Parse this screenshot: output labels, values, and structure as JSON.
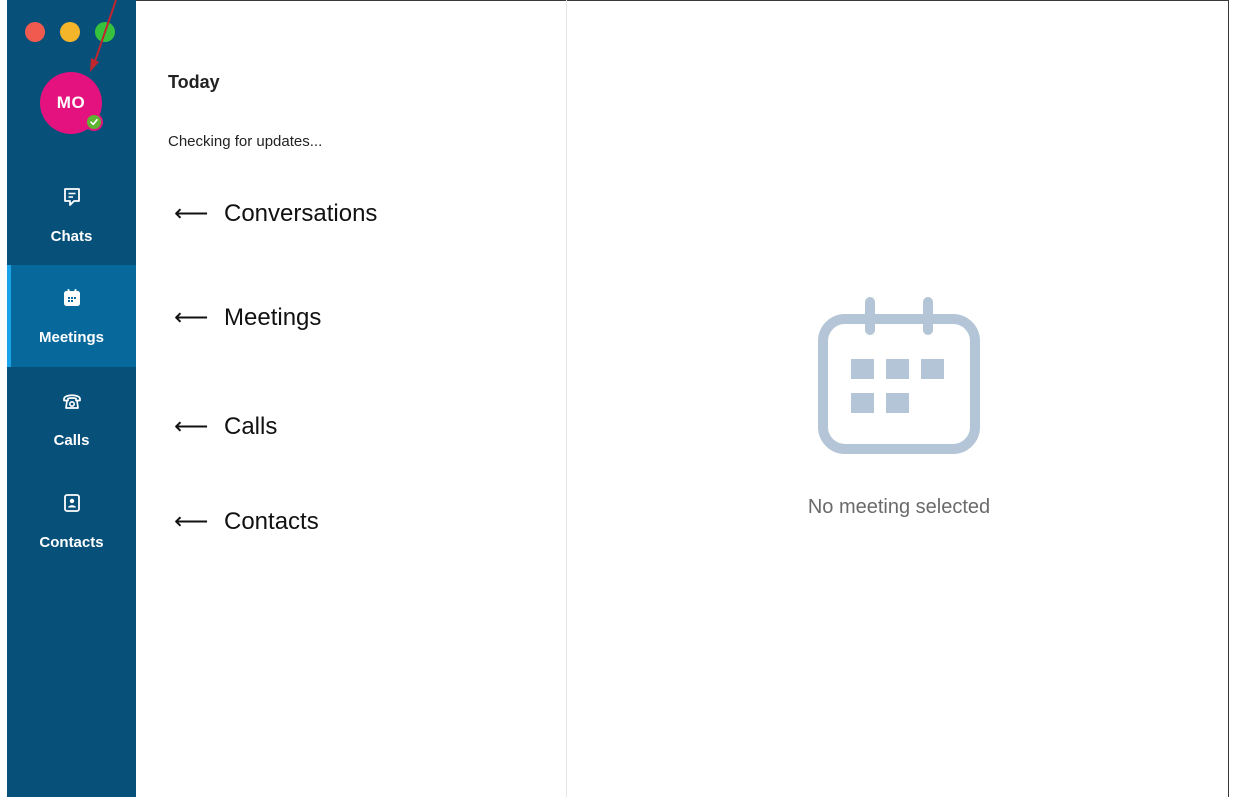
{
  "window": {
    "traffic_lights": [
      "close",
      "minimize",
      "zoom"
    ]
  },
  "sidebar": {
    "avatar_initials": "MO",
    "presence": "available",
    "items": [
      {
        "label": "Chats",
        "icon": "chat-icon",
        "active": false
      },
      {
        "label": "Meetings",
        "icon": "calendar-icon",
        "active": true
      },
      {
        "label": "Calls",
        "icon": "phone-icon",
        "active": false
      },
      {
        "label": "Contacts",
        "icon": "contacts-icon",
        "active": false
      }
    ]
  },
  "list_pane": {
    "title": "Today",
    "status": "Checking for updates..."
  },
  "guides": [
    {
      "arrow": "⟵",
      "label": "Conversations"
    },
    {
      "arrow": "⟵",
      "label": "Meetings"
    },
    {
      "arrow": "⟵",
      "label": "Calls"
    },
    {
      "arrow": "⟵",
      "label": "Contacts"
    }
  ],
  "detail_pane": {
    "empty_message": "No meeting selected",
    "empty_icon": "calendar-icon"
  },
  "colors": {
    "sidebar_bg": "#07507a",
    "active_item_bg": "#07689c",
    "avatar_bg": "#e3127f",
    "presence": "#5fb432",
    "empty_icon": "#b3c5d6"
  }
}
